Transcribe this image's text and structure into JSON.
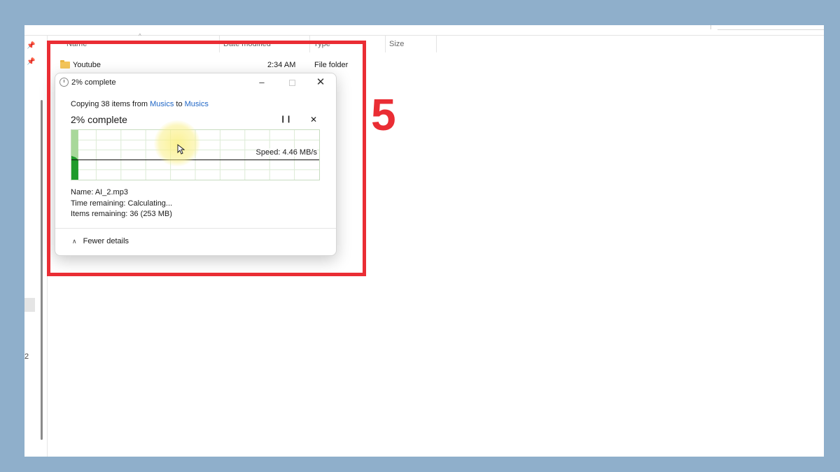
{
  "explorer": {
    "columns": {
      "name": "Name",
      "date_modified": "Date modified",
      "type": "Type",
      "size": "Size"
    },
    "rows": [
      {
        "name": "Youtube",
        "time": "2:34 AM",
        "type": "File folder",
        "size": ""
      }
    ],
    "nav_number": "2"
  },
  "dialog": {
    "title": "2% complete",
    "copy_prefix": "Copying 38 items from ",
    "source": "Musics",
    "to_word": " to ",
    "destination": "Musics",
    "progress_text": "2% complete",
    "progress_percent": 2,
    "speed": "Speed: 4.46 MB/s",
    "details": {
      "name": "Name: AI_2.mp3",
      "time_remaining": "Time remaining: Calculating...",
      "items_remaining": "Items remaining: 36 (253 MB)"
    },
    "fewer_details": "Fewer details"
  },
  "annotation": {
    "step": "5",
    "color": "#ea2d34"
  },
  "colors": {
    "background": "#8fafcb",
    "link": "#1f66c6",
    "progress_fill": "#a8d89a",
    "progress_dark": "#1f9b2a"
  }
}
